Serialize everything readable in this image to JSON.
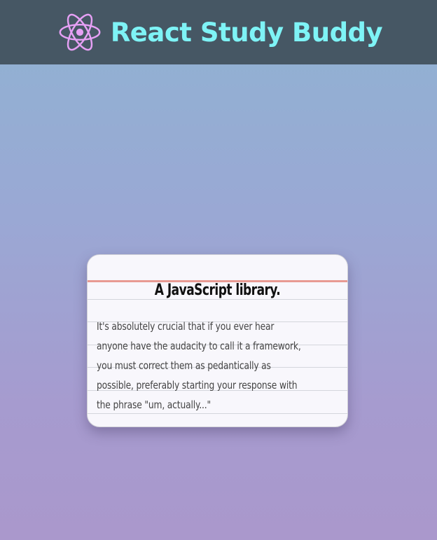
{
  "header": {
    "title": "React Study Buddy",
    "logo_icon": "react-atom-icon",
    "background": "#465764",
    "title_color": "#7ef3f6",
    "logo_color": "#e6a0f5"
  },
  "card": {
    "title": "A JavaScript library.",
    "body_lines": [
      "It's absolutely crucial that if you ever hear",
      "anyone have the audacity to call it a framework,",
      "you must correct them as pedantically as",
      "possible, preferably starting your response with",
      "the phrase \"um, actually...\""
    ],
    "background": "#f8f7fc",
    "margin_line_color": "#e89a93"
  }
}
